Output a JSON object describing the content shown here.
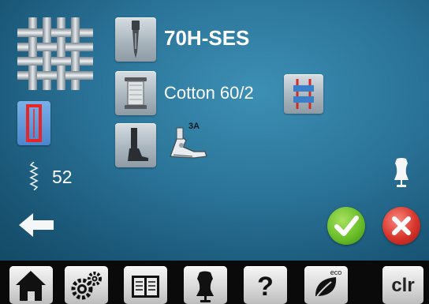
{
  "needle": {
    "label": "70H-SES"
  },
  "thread": {
    "label": "Cotton 60/2"
  },
  "presser_foot": {
    "number": "3A"
  },
  "stitch_length": {
    "value": "52"
  },
  "colors": {
    "screen_bg": "#2a7398",
    "tile_bg": "#b7c2c9",
    "selected_tile": "#5a97d8",
    "confirm_green": "#6bbf2a",
    "cancel_red": "#d8342a",
    "footer_bg": "#0a0a0a"
  },
  "footer": {
    "buttons": [
      {
        "name": "home",
        "icon": "home-icon"
      },
      {
        "name": "settings",
        "icon": "gears-icon"
      },
      {
        "name": "tutorial",
        "icon": "book-icon"
      },
      {
        "name": "sewing-consultant",
        "icon": "dress-form-icon"
      },
      {
        "name": "help",
        "icon": "question-icon"
      },
      {
        "name": "eco",
        "icon": "eco-leaf-icon",
        "badge": "eco"
      },
      {
        "name": "clear",
        "label": "clr"
      }
    ]
  }
}
